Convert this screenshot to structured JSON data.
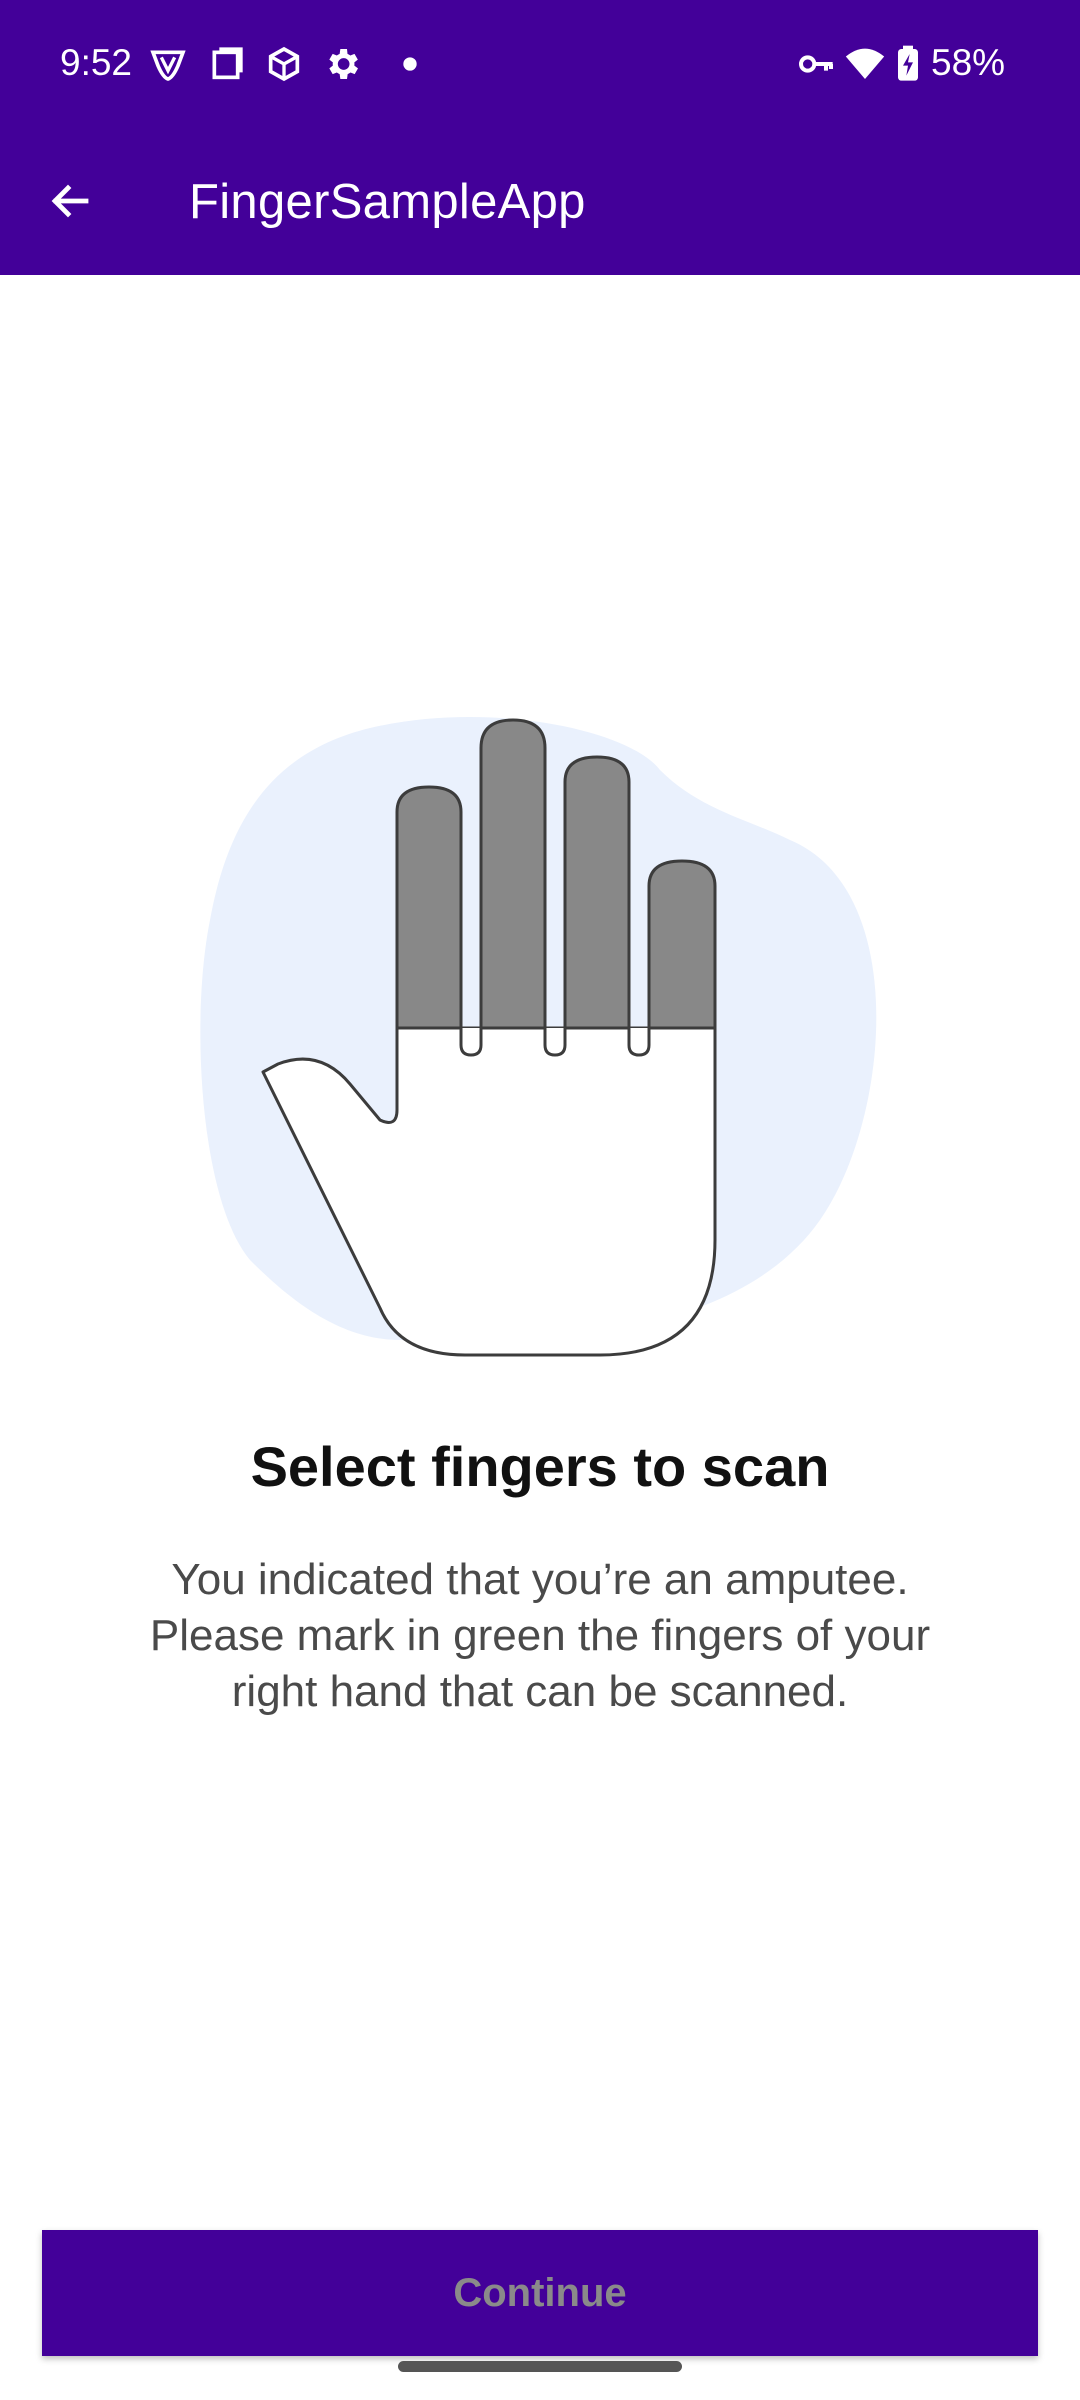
{
  "status_bar": {
    "time": "9:52",
    "battery_percent": "58%",
    "icons": [
      "shield-v-icon",
      "screenshot-icon",
      "cube-icon",
      "settings-icon",
      "notification-dot-icon",
      "vpn-key-icon",
      "wifi-icon",
      "battery-charging-icon"
    ]
  },
  "app_bar": {
    "title": "FingerSampleApp",
    "back_icon": "arrow-back-icon"
  },
  "illustration": {
    "icon": "hand-fingers-icon",
    "finger_color": "#888888",
    "blob_color": "#EAF1FD"
  },
  "main": {
    "heading": "Select fingers to scan",
    "description": "You indicated that you’re an amputee. Please mark in green the fingers of your right hand that can be scanned."
  },
  "footer": {
    "continue_label": "Continue"
  },
  "colors": {
    "primary": "#430099",
    "disabled_text": "#8A8A8A"
  }
}
